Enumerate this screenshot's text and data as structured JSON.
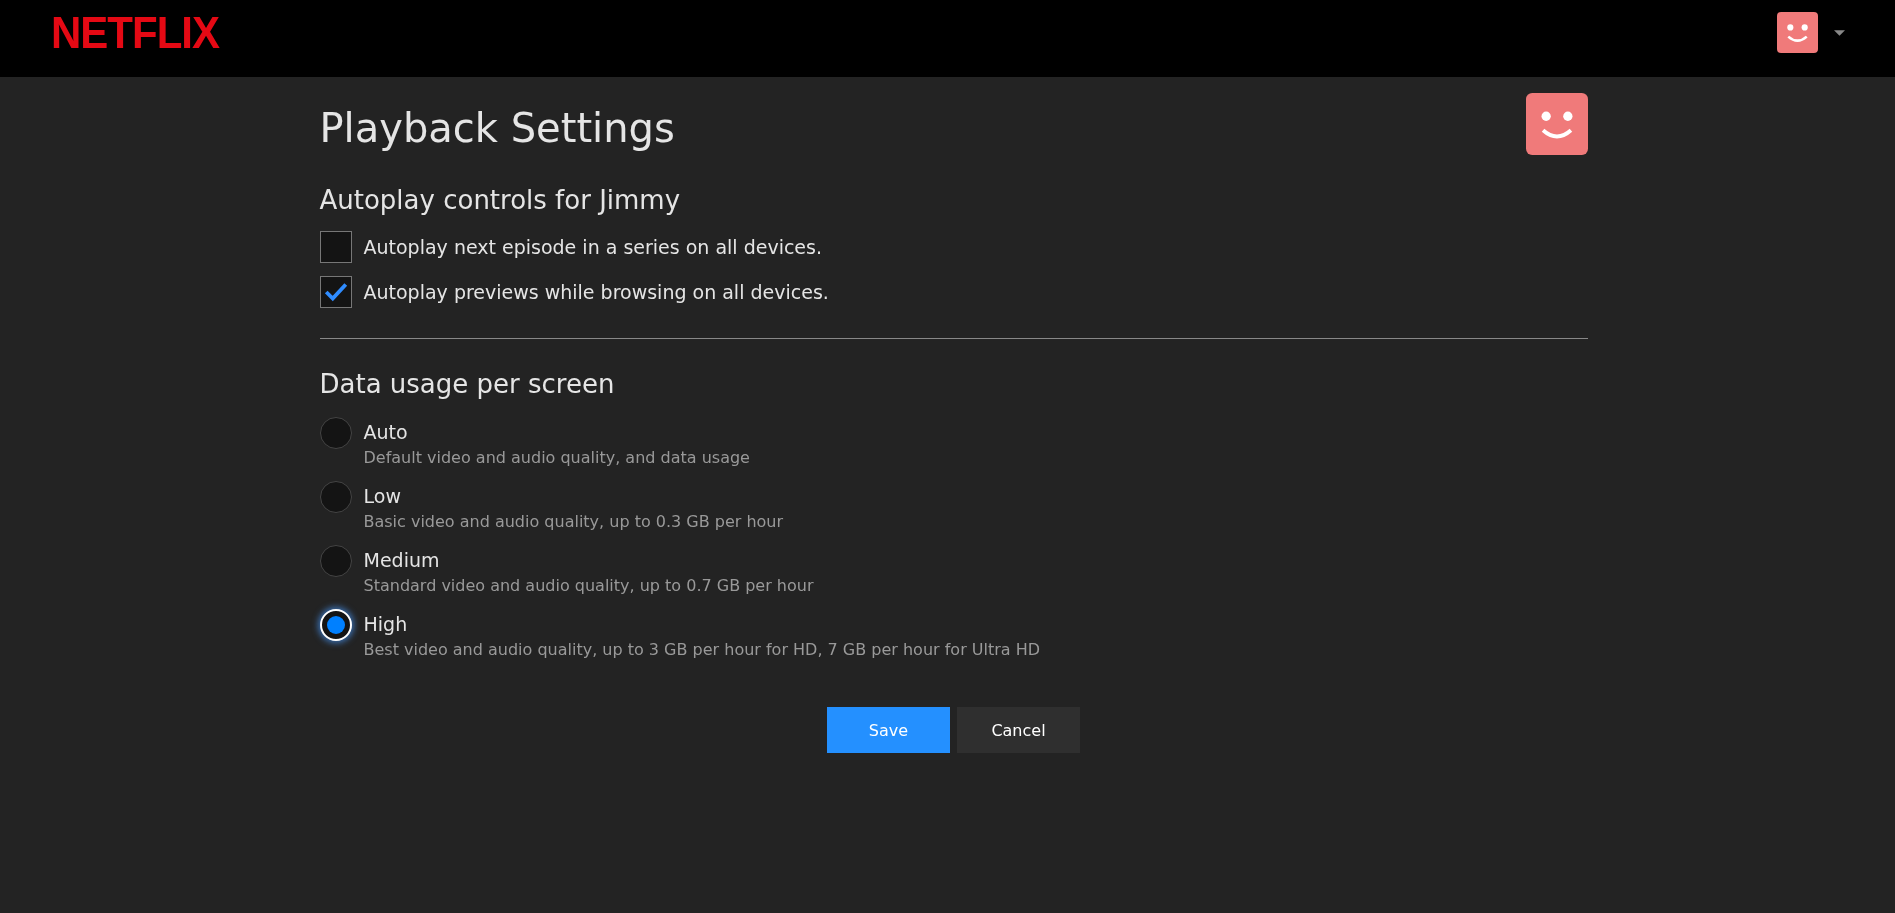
{
  "header": {
    "logo": "NETFLIX"
  },
  "page": {
    "title": "Playback Settings"
  },
  "autoplay": {
    "heading": "Autoplay controls for Jimmy",
    "options": [
      {
        "label": "Autoplay next episode in a series on all devices.",
        "checked": false
      },
      {
        "label": "Autoplay previews while browsing on all devices.",
        "checked": true
      }
    ]
  },
  "data_usage": {
    "heading": "Data usage per screen",
    "options": [
      {
        "label": "Auto",
        "description": "Default video and audio quality, and data usage",
        "selected": false
      },
      {
        "label": "Low",
        "description": "Basic video and audio quality, up to 0.3 GB per hour",
        "selected": false
      },
      {
        "label": "Medium",
        "description": "Standard video and audio quality, up to 0.7 GB per hour",
        "selected": false
      },
      {
        "label": "High",
        "description": "Best video and audio quality, up to 3 GB per hour for HD, 7 GB per hour for Ultra HD",
        "selected": true
      }
    ]
  },
  "buttons": [
    {
      "label": "Save",
      "kind": "primary"
    },
    {
      "label": "Cancel",
      "kind": "secondary"
    }
  ]
}
